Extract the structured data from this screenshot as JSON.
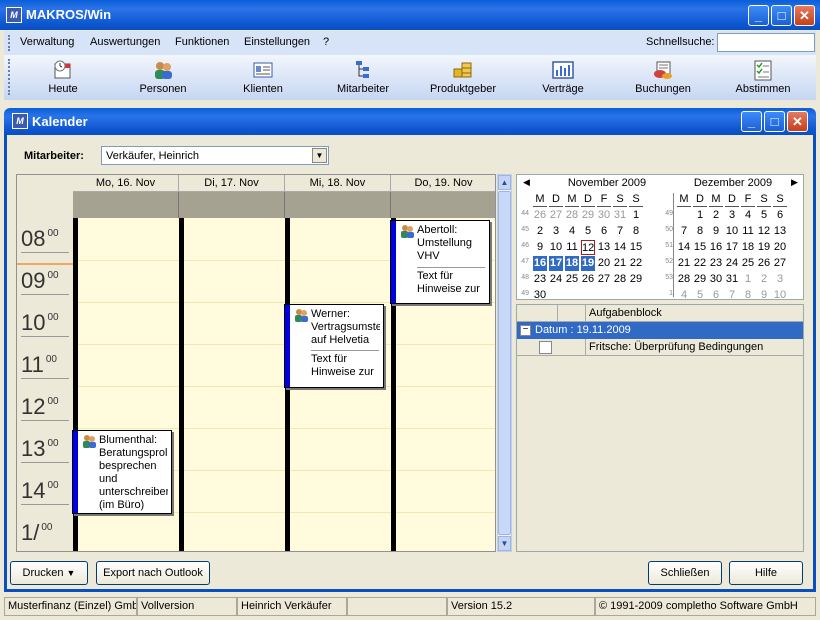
{
  "app": {
    "title": "MAKROS/Win",
    "icon_glyph": "M"
  },
  "menu": {
    "items": [
      "Verwaltung",
      "Auswertungen",
      "Funktionen",
      "Einstellungen",
      "?"
    ],
    "quicksearch_label": "Schnellsuche:",
    "quicksearch_value": ""
  },
  "toolbar": {
    "buttons": [
      {
        "label": "Heute",
        "icon": "calendar-clock-icon"
      },
      {
        "label": "Personen",
        "icon": "people-icon"
      },
      {
        "label": "Klienten",
        "icon": "client-card-icon"
      },
      {
        "label": "Mitarbeiter",
        "icon": "org-tree-icon"
      },
      {
        "label": "Produktgeber",
        "icon": "boxes-icon"
      },
      {
        "label": "Verträge",
        "icon": "contract-chart-icon"
      },
      {
        "label": "Buchungen",
        "icon": "bookings-icon"
      },
      {
        "label": "Abstimmen",
        "icon": "checklist-icon"
      }
    ]
  },
  "calendar_window": {
    "title": "Kalender"
  },
  "filter": {
    "label": "Mitarbeiter:",
    "value": "Verkäufer, Heinrich"
  },
  "days": [
    "Mo, 16. Nov",
    "Di, 17. Nov",
    "Mi, 18. Nov",
    "Do, 19. Nov"
  ],
  "hours": [
    {
      "h": "08",
      "m": "00"
    },
    {
      "h": "09",
      "m": "00"
    },
    {
      "h": "10",
      "m": "00"
    },
    {
      "h": "11",
      "m": "00"
    },
    {
      "h": "12",
      "m": "00"
    },
    {
      "h": "13",
      "m": "00"
    },
    {
      "h": "14",
      "m": "00"
    },
    {
      "h": "1/",
      "m": "00"
    }
  ],
  "appointments": [
    {
      "title": "Abertoll: Umstellung VHV",
      "sub": "Text für Hinweise zur"
    },
    {
      "title": "Werner: Vertragsumstel auf Helvetia",
      "sub": "Text für Hinweise zur"
    },
    {
      "title": "Blumenthal: Beratungsprol besprechen und unterschreiben (im Büro)",
      "sub": ""
    }
  ],
  "minical": {
    "month1": "November 2009",
    "month2": "Dezember 2009",
    "weekday_headers": [
      "M",
      "D",
      "M",
      "D",
      "F",
      "S",
      "S"
    ],
    "nov_weeks": [
      "44",
      "45",
      "46",
      "47",
      "48",
      "49"
    ],
    "nov_rows": [
      [
        "26",
        "27",
        "28",
        "29",
        "30",
        "31",
        "1"
      ],
      [
        "2",
        "3",
        "4",
        "5",
        "6",
        "7",
        "8"
      ],
      [
        "9",
        "10",
        "11",
        "12",
        "13",
        "14",
        "15"
      ],
      [
        "16",
        "17",
        "18",
        "19",
        "20",
        "21",
        "22"
      ],
      [
        "23",
        "24",
        "25",
        "26",
        "27",
        "28",
        "29"
      ],
      [
        "30",
        "",
        "",
        "",
        "",
        "",
        ""
      ]
    ],
    "dec_weeks": [
      "49",
      "50",
      "51",
      "52",
      "53",
      "1"
    ],
    "dec_rows": [
      [
        "",
        "1",
        "2",
        "3",
        "4",
        "5",
        "6"
      ],
      [
        "7",
        "8",
        "9",
        "10",
        "11",
        "12",
        "13"
      ],
      [
        "14",
        "15",
        "16",
        "17",
        "18",
        "19",
        "20"
      ],
      [
        "21",
        "22",
        "23",
        "24",
        "25",
        "26",
        "27"
      ],
      [
        "28",
        "29",
        "30",
        "31",
        "1",
        "2",
        "3"
      ],
      [
        "4",
        "5",
        "6",
        "7",
        "8",
        "9",
        "10"
      ]
    ],
    "today": "12",
    "selected": [
      "16",
      "17",
      "18",
      "19"
    ]
  },
  "tasks": {
    "column_header": "Aufgabenblock",
    "group_label": "Datum : 19.11.2009",
    "items": [
      "Fritsche: Überprüfung Bedingungen"
    ]
  },
  "buttons": {
    "print": "Drucken",
    "export": "Export nach Outlook",
    "close": "Schließen",
    "help": "Hilfe"
  },
  "statusbar": {
    "company": "Musterfinanz (Einzel) Gmb",
    "license": "Vollversion",
    "user": "Heinrich Verkäufer",
    "empty": "",
    "version": "Version 15.2",
    "copyright": "© 1991-2009 completho Software GmbH"
  },
  "colors": {
    "title_blue": "#0a5fd8",
    "appointment_bar": "#0000e0",
    "day_background": "#fffbdc",
    "selection": "#316ac5"
  }
}
